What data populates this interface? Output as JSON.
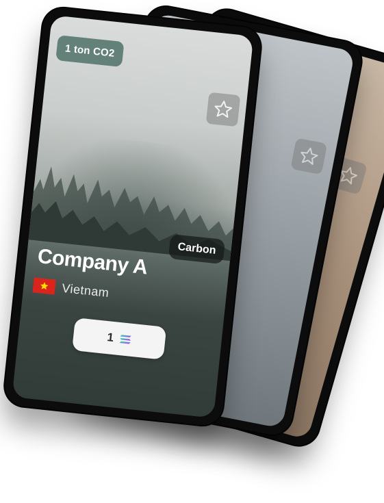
{
  "card": {
    "badge": "1 ton CO2",
    "category": "Carbon",
    "company": "Company A",
    "country": "Vietnam",
    "price": "1",
    "currency_icon": "solana-icon",
    "favorite_icon": "star-outline-icon",
    "flag_icon": "vietnam-flag-icon"
  },
  "colors": {
    "badge_bg": "#4b6e64",
    "flag_red": "#da251d",
    "flag_star": "#ffdd00",
    "price_bg": "#f4f4f4"
  }
}
